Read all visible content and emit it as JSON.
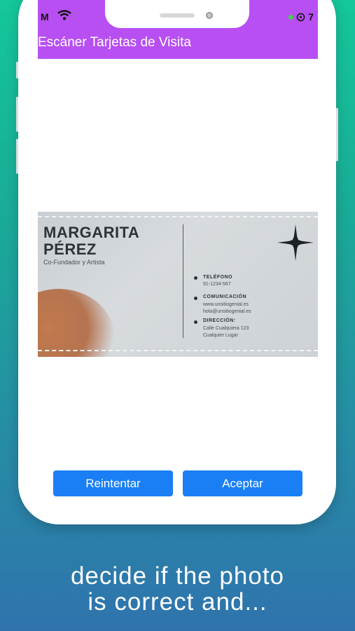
{
  "status_bar": {
    "time_fragment": "M",
    "battery_fragment": "7"
  },
  "app": {
    "title": "Escáner Tarjetas de Visita",
    "accent_color": "#b84ff2"
  },
  "photo": {
    "name_line1": "MARGARITA",
    "name_line2": "PÉREZ",
    "role": "Co-Fundador y Artista",
    "contacts": [
      {
        "heading": "TELÉFONO",
        "lines": [
          "91-1234-567"
        ]
      },
      {
        "heading": "COMUNICACIÓN",
        "lines": [
          "www.unsitiogenial.es",
          "hola@unsitiogenial.es"
        ]
      },
      {
        "heading": "DIRECCIÓN:",
        "lines": [
          "Calle Cualquiera 123",
          "Cualquier Lugar"
        ]
      }
    ]
  },
  "actions": {
    "retry_label": "Reintentar",
    "accept_label": "Aceptar",
    "button_color": "#1a7ff5"
  },
  "caption": {
    "line1": "decide if the photo",
    "line2": "is correct and..."
  }
}
